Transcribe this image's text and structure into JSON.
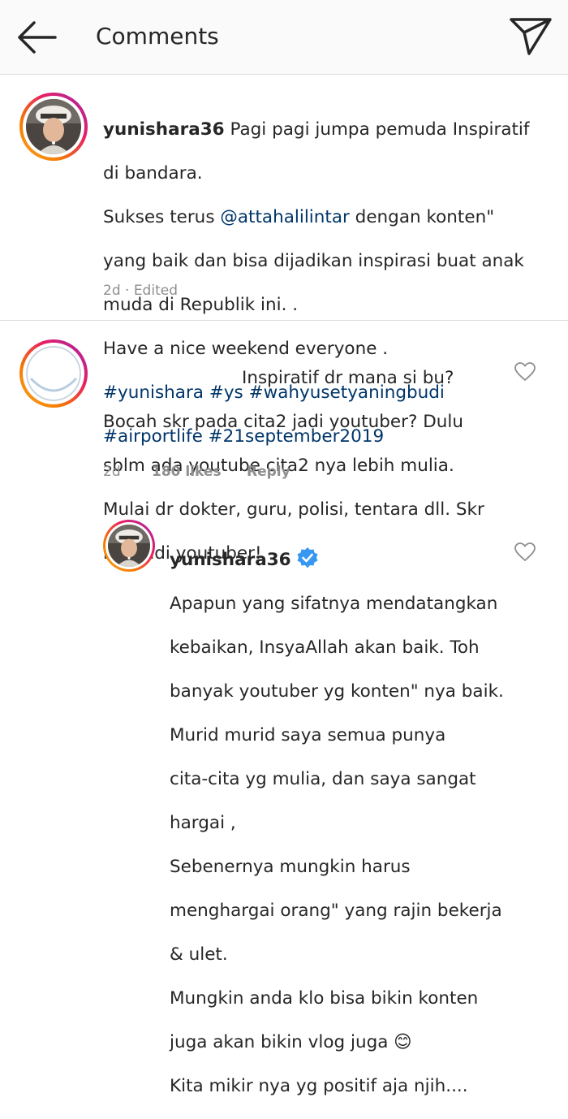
{
  "header": {
    "title": "Comments",
    "back_icon": "back-arrow-icon",
    "send_icon": "direct-send-icon"
  },
  "caption": {
    "username": "yunishara36",
    "lines": [
      "Pagi pagi jumpa pemuda Inspiratif",
      "di bandara.",
      "Sukses terus ",
      "@attahalilintar",
      " dengan konten\"",
      "yang baik dan bisa dijadikan inspirasi buat anak",
      "muda di Republik ini. .",
      "Have a nice weekend everyone ."
    ],
    "hashtags_line1": "#yunishara #ys #wahyusetyaningbudi",
    "hashtags_line2": "#airportlife #21september2019",
    "time": "2d · Edited"
  },
  "comment": {
    "lines": [
      "Inspiratif dr mana si bu?",
      "Bocah skr pada cita2 jadi youtuber? Dulu",
      "sblm ada youtube cita2 nya lebih mulia.",
      "Mulai dr dokter, guru, polisi, tentara dll. Skr",
      "kok jadi youtuber!"
    ],
    "time": "2d",
    "likes": "180 likes",
    "reply": "Reply"
  },
  "reply": {
    "username": "yunishara36",
    "verified_icon": "verified-badge-icon",
    "lines": [
      "Apapun yang sifatnya mendatangkan",
      "kebaikan, InsyaAllah akan baik. Toh",
      "banyak youtuber yg konten\" nya baik.",
      "Murid murid saya semua punya",
      "cita-cita yg mulia, dan saya sangat",
      "hargai ,",
      "Sebenernya mungkin harus",
      "menghargai orang\" yang rajin bekerja",
      "& ulet.",
      "Mungkin anda klo bisa bikin konten",
      "juga akan bikin vlog juga 😊",
      "Kita mikir nya yg positif aja njih...."
    ]
  },
  "colors": {
    "link": "#003569",
    "meta": "#8e8e8e",
    "divider": "#dbdbdb",
    "verified": "#3897f0"
  }
}
